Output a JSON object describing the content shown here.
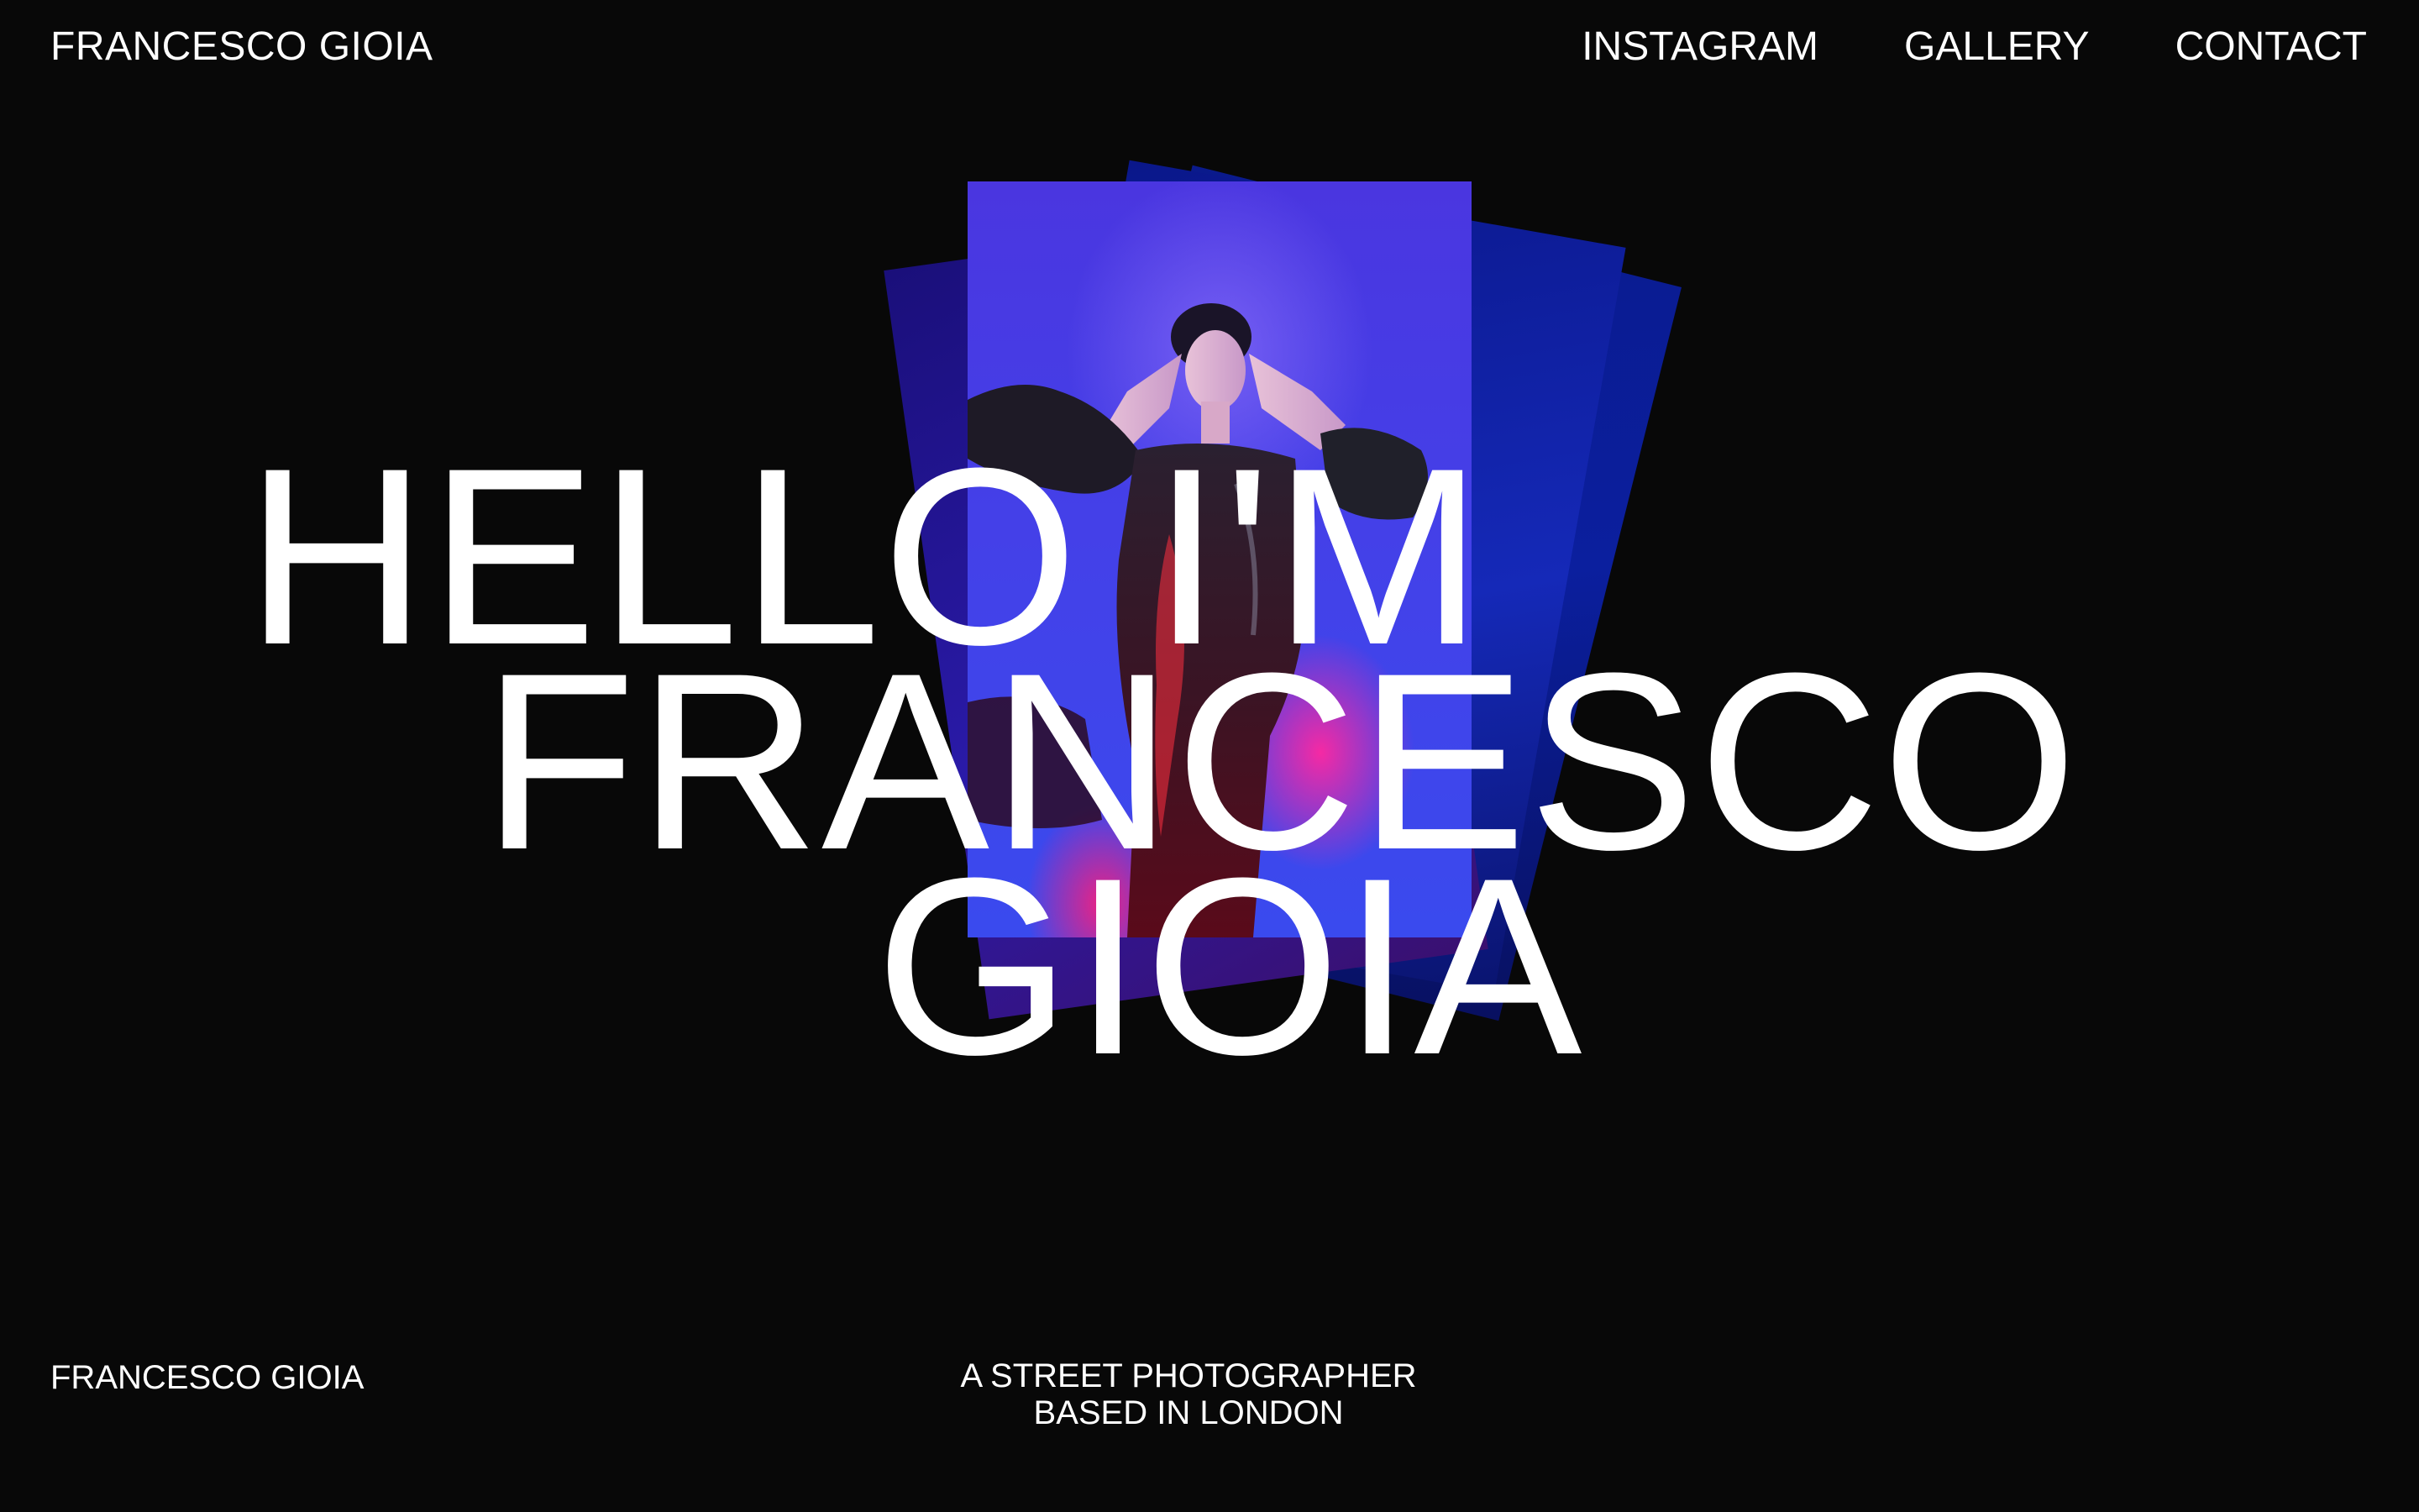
{
  "header": {
    "brand": "FRANCESCO GIOIA",
    "nav": [
      {
        "label": "INSTAGRAM"
      },
      {
        "label": "GALLERY"
      },
      {
        "label": "CONTACT"
      }
    ]
  },
  "hero": {
    "lines": [
      "HELLO I'M",
      "FRANCESCO",
      "GIOIA"
    ]
  },
  "footer": {
    "brand": "FRANCESCO GIOIA",
    "tagline": [
      "A STREET PHOTOGRAPHER",
      "BASED IN LONDON"
    ]
  },
  "colors": {
    "background": "#080808",
    "text": "#ffffff",
    "photo_blue": "#4440e8",
    "photo_pink": "#ff28a0",
    "stack_blue": "#0b1f9e"
  }
}
